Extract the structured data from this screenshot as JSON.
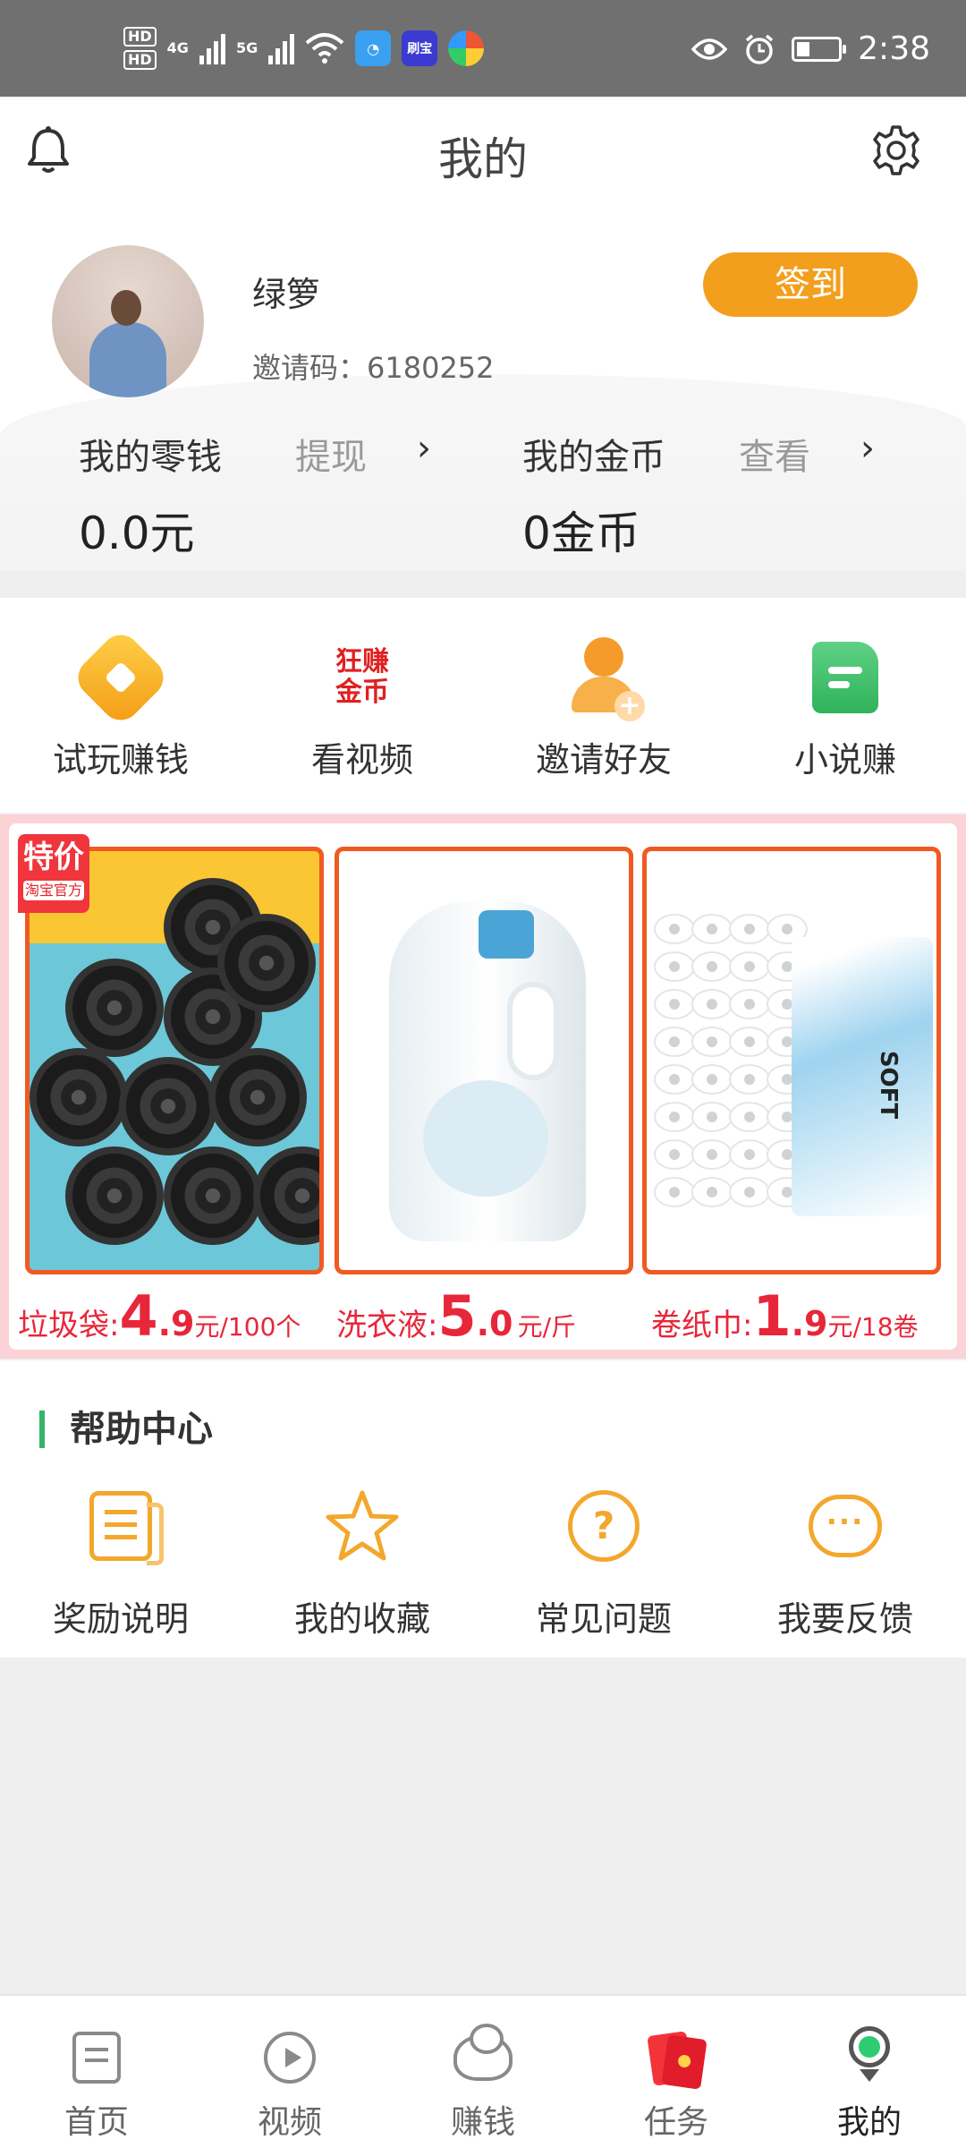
{
  "status_bar": {
    "network1": "4G",
    "network2": "5G",
    "hd1": "HD",
    "hd2": "HD",
    "app_label": "刷宝",
    "time": "2:38"
  },
  "header": {
    "title": "我的",
    "icons": {
      "left": "bell-icon",
      "right": "gear-icon"
    }
  },
  "profile": {
    "username": "绿箩",
    "invite_code": "邀请码：6180252",
    "checkin_label": "签到"
  },
  "wallet": {
    "change_label": "我的零钱",
    "withdraw_label": "提现",
    "change_value": "0.0元",
    "coins_label": "我的金币",
    "view_label": "查看",
    "coins_value": "0金币",
    "chevron": "›"
  },
  "quick_actions": [
    {
      "label": "试玩赚钱",
      "icon": "game-icon"
    },
    {
      "label": "看视频",
      "icon": "video-coin-icon",
      "icon_text_1": "狂赚",
      "icon_text_2": "金币"
    },
    {
      "label": "邀请好友",
      "icon": "invite-friend-icon"
    },
    {
      "label": "小说赚",
      "icon": "novel-icon"
    }
  ],
  "promo": {
    "tag": "特价",
    "tag_sub": "淘宝官方",
    "products": [
      {
        "name": "垃圾袋:",
        "price_big": "4",
        "price_rest": ".9",
        "unit": "元/100个"
      },
      {
        "name": "洗衣液:",
        "price_big": "5",
        "price_rest": ".0",
        "unit": "元/斤"
      },
      {
        "name": "卷纸巾:",
        "price_big": "1",
        "price_rest": ".9",
        "unit": "元/18卷"
      }
    ],
    "pack_text": "SOFT"
  },
  "help_center": {
    "title": "帮助中心",
    "items": [
      {
        "label": "奖励说明",
        "icon": "reward-doc-icon"
      },
      {
        "label": "我的收藏",
        "icon": "star-icon"
      },
      {
        "label": "常见问题",
        "icon": "question-icon"
      },
      {
        "label": "我要反馈",
        "icon": "feedback-chat-icon"
      }
    ]
  },
  "bottom_nav": [
    {
      "label": "首页",
      "icon": "home-doc-icon"
    },
    {
      "label": "视频",
      "icon": "play-icon"
    },
    {
      "label": "赚钱",
      "icon": "ingot-icon"
    },
    {
      "label": "任务",
      "icon": "red-envelope-icon"
    },
    {
      "label": "我的",
      "icon": "profile-pin-icon",
      "active": true
    }
  ],
  "colors": {
    "accent_orange": "#f39f1e",
    "promo_red": "#e8263a",
    "help_accent": "#35b36a",
    "status_bar": "#707070"
  }
}
